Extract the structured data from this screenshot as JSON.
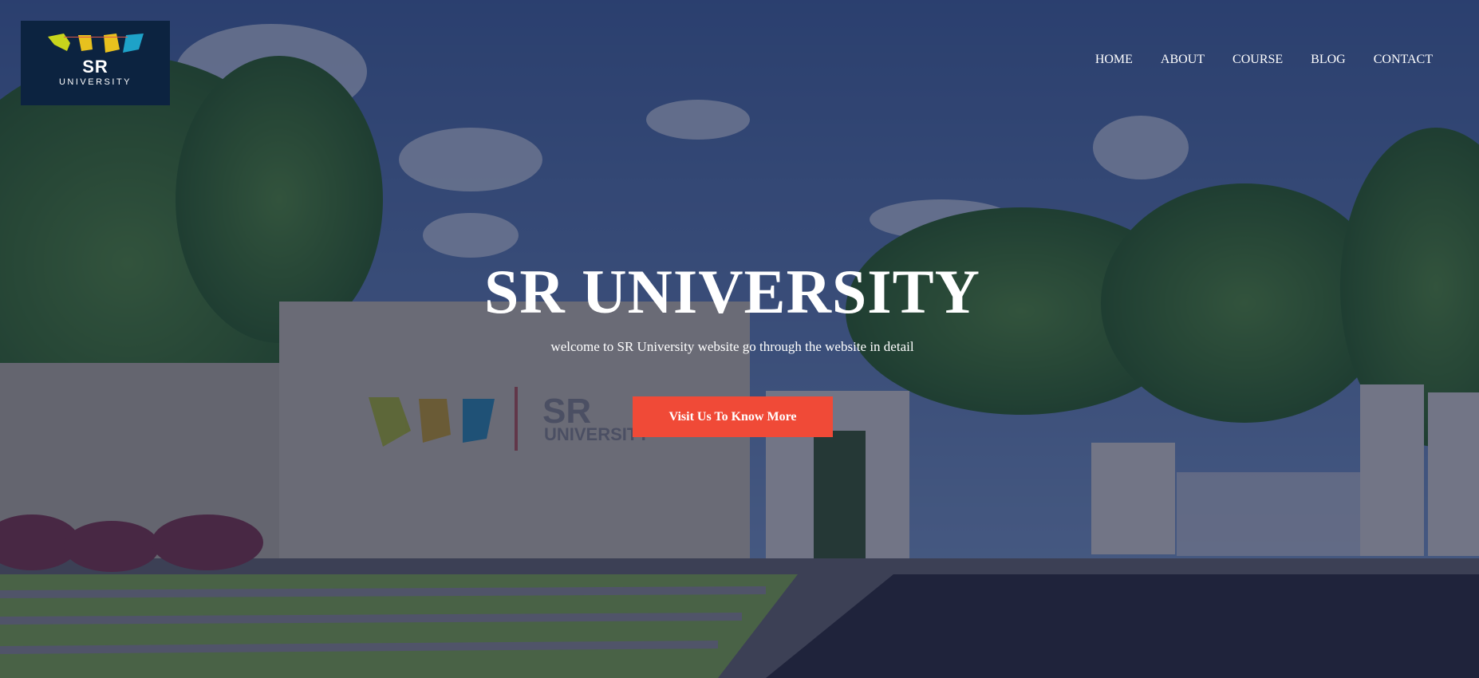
{
  "brand": {
    "logo_mark": "SR",
    "logo_subtitle": "UNIVERSITY",
    "colors": {
      "yellow": "#c8d51c",
      "gold": "#e8c11e",
      "teal": "#1ea2c8",
      "navy": "#0c2340",
      "accent": "#f04a37"
    }
  },
  "nav": {
    "items": [
      {
        "label": "HOME"
      },
      {
        "label": "ABOUT"
      },
      {
        "label": "COURSE"
      },
      {
        "label": "BLOG"
      },
      {
        "label": "CONTACT"
      }
    ]
  },
  "hero": {
    "title": "SR UNIVERSITY",
    "subtitle": "welcome to SR University website go through the website in detail",
    "cta_label": "Visit Us To Know More"
  }
}
